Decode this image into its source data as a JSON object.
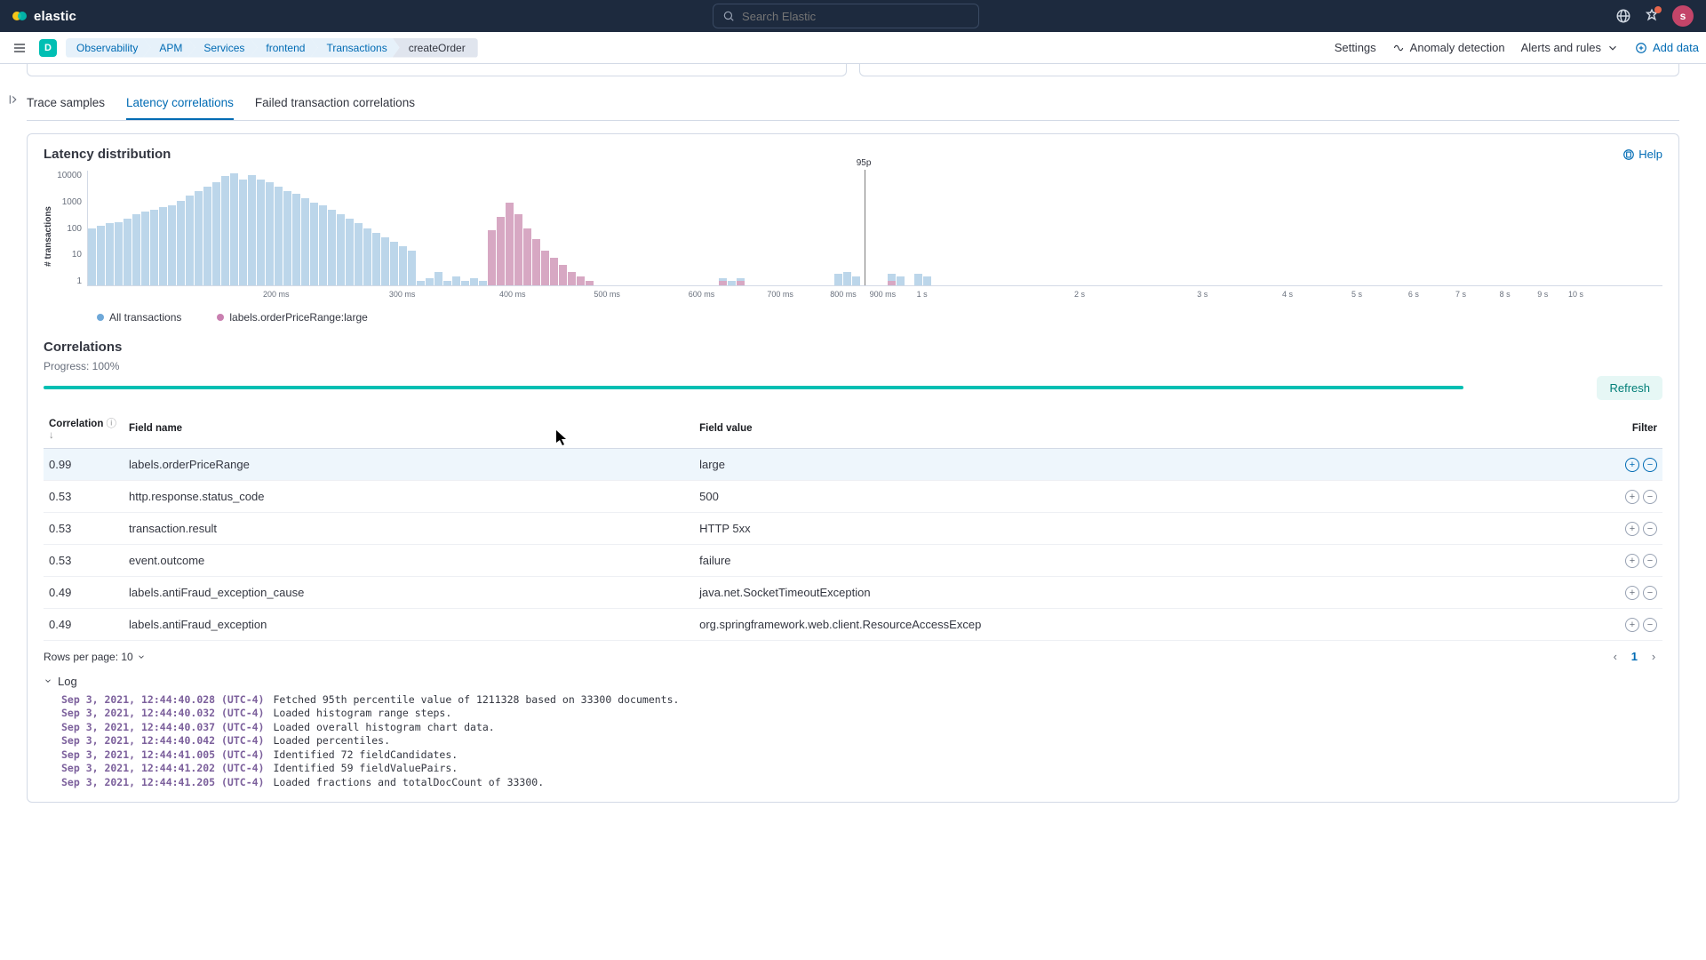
{
  "brand": "elastic",
  "search": {
    "placeholder": "Search Elastic"
  },
  "avatar_initial": "s",
  "space_initial": "D",
  "breadcrumbs": [
    "Observability",
    "APM",
    "Services",
    "frontend",
    "Transactions",
    "createOrder"
  ],
  "subactions": {
    "settings": "Settings",
    "anomaly": "Anomaly detection",
    "alerts": "Alerts and rules",
    "add_data": "Add data"
  },
  "tabs": {
    "trace": "Trace samples",
    "latency": "Latency correlations",
    "failed": "Failed transaction correlations"
  },
  "panel": {
    "title": "Latency distribution",
    "help": "Help"
  },
  "chart_data": {
    "type": "bar",
    "ylabel": "# transactions",
    "y_ticks": [
      "10000",
      "1000",
      "100",
      "10",
      "1"
    ],
    "x_ticks": [
      "200 ms",
      "300 ms",
      "400 ms",
      "500 ms",
      "600 ms",
      "700 ms",
      "800 ms",
      "900 ms",
      "1 s",
      "2 s",
      "3 s",
      "4 s",
      "5 s",
      "6 s",
      "7 s",
      "8 s",
      "9 s",
      "10 s"
    ],
    "x_tick_pct": [
      12,
      20,
      27,
      33,
      39,
      44,
      48,
      50.5,
      53,
      63,
      70.8,
      76.2,
      80.6,
      84.2,
      87.2,
      90,
      92.4,
      94.5
    ],
    "p95_label": "95p",
    "p95_pct": 49.3,
    "series": [
      {
        "name": "All transactions",
        "color": "#bcd6ea",
        "heights": [
          50,
          52,
          54,
          55,
          58,
          62,
          64,
          66,
          68,
          70,
          74,
          78,
          82,
          86,
          90,
          95,
          98,
          92,
          96,
          92,
          90,
          86,
          82,
          80,
          76,
          72,
          70,
          66,
          62,
          58,
          54,
          50,
          46,
          42,
          38,
          34,
          30,
          4,
          6,
          12,
          4,
          8,
          4,
          6,
          4,
          48,
          60,
          72,
          62,
          50,
          40,
          30,
          24,
          18,
          12,
          8,
          4,
          0,
          0,
          0,
          0,
          0,
          0,
          0,
          0,
          0,
          0,
          0,
          0,
          0,
          0,
          6,
          4,
          6,
          0,
          0,
          0,
          0,
          0,
          0,
          0,
          0,
          0,
          0,
          10,
          12,
          8,
          0,
          0,
          0,
          10,
          8,
          0,
          10,
          8,
          0,
          0,
          0,
          0
        ]
      },
      {
        "name": "labels.orderPriceRange:large",
        "color": "#d7a8c3",
        "heights": [
          0,
          0,
          0,
          0,
          0,
          0,
          0,
          0,
          0,
          0,
          0,
          0,
          0,
          0,
          0,
          0,
          0,
          0,
          0,
          0,
          0,
          0,
          0,
          0,
          0,
          0,
          0,
          0,
          0,
          0,
          0,
          0,
          0,
          0,
          0,
          0,
          0,
          0,
          0,
          0,
          0,
          0,
          0,
          0,
          0,
          48,
          60,
          72,
          62,
          50,
          40,
          30,
          24,
          18,
          12,
          8,
          4,
          0,
          0,
          0,
          0,
          0,
          0,
          0,
          0,
          0,
          0,
          0,
          0,
          0,
          0,
          4,
          0,
          4,
          0,
          0,
          0,
          0,
          0,
          0,
          0,
          0,
          0,
          0,
          0,
          0,
          0,
          0,
          0,
          0,
          4,
          0,
          0,
          0,
          0,
          0,
          0,
          0,
          0
        ]
      }
    ]
  },
  "legend": {
    "all": "All transactions",
    "selected": "labels.orderPriceRange:large"
  },
  "correlations": {
    "title": "Correlations",
    "progress_label": "Progress: 100%",
    "refresh": "Refresh",
    "headers": {
      "corr": "Correlation",
      "sort_hint": "ⓘ ↓",
      "name": "Field name",
      "value": "Field value",
      "filter": "Filter"
    },
    "rows": [
      {
        "corr": "0.99",
        "name": "labels.orderPriceRange",
        "value": "large",
        "selected": true
      },
      {
        "corr": "0.53",
        "name": "http.response.status_code",
        "value": "500"
      },
      {
        "corr": "0.53",
        "name": "transaction.result",
        "value": "HTTP 5xx"
      },
      {
        "corr": "0.53",
        "name": "event.outcome",
        "value": "failure"
      },
      {
        "corr": "0.49",
        "name": "labels.antiFraud_exception_cause",
        "value": "java.net.SocketTimeoutException"
      },
      {
        "corr": "0.49",
        "name": "labels.antiFraud_exception",
        "value": "org.springframework.web.client.ResourceAccessExcep"
      }
    ],
    "rows_per_page": "Rows per page: 10",
    "page": "1"
  },
  "log": {
    "title": "Log",
    "lines": [
      {
        "ts": "Sep 3, 2021, 12:44:40.028 (UTC-4)",
        "msg": "Fetched 95th percentile value of 1211328 based on 33300 documents."
      },
      {
        "ts": "Sep 3, 2021, 12:44:40.032 (UTC-4)",
        "msg": "Loaded histogram range steps."
      },
      {
        "ts": "Sep 3, 2021, 12:44:40.037 (UTC-4)",
        "msg": "Loaded overall histogram chart data."
      },
      {
        "ts": "Sep 3, 2021, 12:44:40.042 (UTC-4)",
        "msg": "Loaded percentiles."
      },
      {
        "ts": "Sep 3, 2021, 12:44:41.005 (UTC-4)",
        "msg": "Identified 72 fieldCandidates."
      },
      {
        "ts": "Sep 3, 2021, 12:44:41.202 (UTC-4)",
        "msg": "Identified 59 fieldValuePairs."
      },
      {
        "ts": "Sep 3, 2021, 12:44:41.205 (UTC-4)",
        "msg": "Loaded fractions and totalDocCount of 33300."
      }
    ]
  }
}
